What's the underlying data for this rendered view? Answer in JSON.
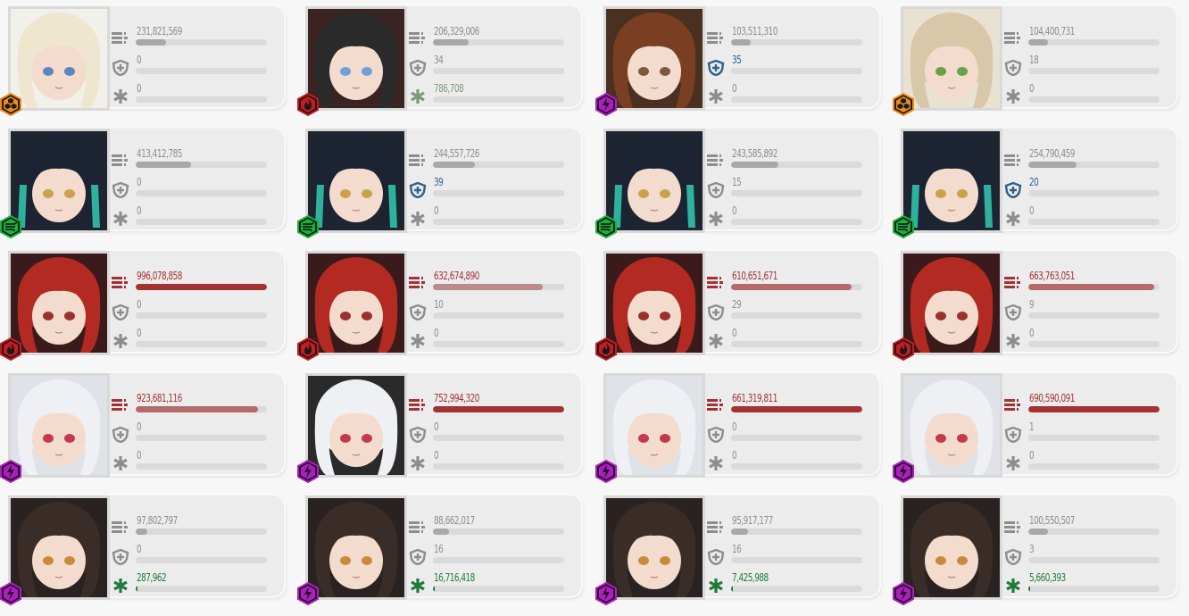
{
  "icons": {
    "damage": "damage-bars-icon",
    "shield": "shield-cross-icon",
    "heal": "heal-asterisk-icon"
  },
  "colors": {
    "grey_text": "#8d8d8d",
    "grey_bar": "#a8a8a8",
    "blue": "#2f5f8a",
    "green": "#1f7a38",
    "green_light": "#7a9a80",
    "red": "#a33234",
    "red_mid": "#b46a6b",
    "red_light": "#bb8a8a",
    "track": "#dadada"
  },
  "elements": {
    "iron": {
      "icon": "iron-element-icon",
      "color": "#f08a12"
    },
    "fire": {
      "icon": "fire-element-icon",
      "color": "#c61b20"
    },
    "electric": {
      "icon": "electric-element-icon",
      "color": "#b21ac6"
    },
    "wind": {
      "icon": "wind-element-icon",
      "color": "#14b53a"
    },
    "water": {
      "icon": "water-element-icon",
      "color": "#1b7bd6"
    }
  },
  "cards": [
    {
      "element": "iron",
      "portrait": {
        "hair": "#efe6cf",
        "bg": "#f2f0ea",
        "eye": "#5b86c2"
      },
      "damage": {
        "value": "231,821,569",
        "fill": 0.23,
        "tone": "grey"
      },
      "shield": {
        "value": "0",
        "fill": 0,
        "tone": "grey"
      },
      "heal": {
        "value": "0",
        "fill": 0,
        "tone": "grey"
      }
    },
    {
      "element": "fire",
      "portrait": {
        "hair": "#2b2b2b",
        "bg": "#3a2422",
        "eye": "#6fa0d8"
      },
      "damage": {
        "value": "206,329,006",
        "fill": 0.27,
        "tone": "grey"
      },
      "shield": {
        "value": "34",
        "fill": 0,
        "tone": "grey"
      },
      "heal": {
        "value": "786,708",
        "fill": 0,
        "tone": "green_light"
      }
    },
    {
      "element": "electric",
      "portrait": {
        "hair": "#7a3f22",
        "bg": "#4a3020",
        "eye": "#7a5a3a"
      },
      "damage": {
        "value": "103,511,310",
        "fill": 0.15,
        "tone": "grey"
      },
      "shield": {
        "value": "35",
        "fill": 0,
        "tone": "blue"
      },
      "heal": {
        "value": "0",
        "fill": 0,
        "tone": "grey"
      }
    },
    {
      "element": "iron",
      "portrait": {
        "hair": "#d8c7a8",
        "bg": "#e9e1d2",
        "eye": "#6aa048"
      },
      "damage": {
        "value": "104,400,731",
        "fill": 0.15,
        "tone": "grey"
      },
      "shield": {
        "value": "18",
        "fill": 0,
        "tone": "grey"
      },
      "heal": {
        "value": "0",
        "fill": 0,
        "tone": "grey"
      }
    },
    {
      "element": "wind",
      "portrait": {
        "hair": "#1c2333",
        "bg": "#1e2430",
        "eye": "#c9a24b",
        "accent": "#33d6b8"
      },
      "damage": {
        "value": "413,412,785",
        "fill": 0.42,
        "tone": "grey"
      },
      "shield": {
        "value": "0",
        "fill": 0,
        "tone": "grey"
      },
      "heal": {
        "value": "0",
        "fill": 0,
        "tone": "grey"
      }
    },
    {
      "element": "wind",
      "portrait": {
        "hair": "#1c2333",
        "bg": "#1e2430",
        "eye": "#c9a24b",
        "accent": "#33d6b8"
      },
      "damage": {
        "value": "244,557,726",
        "fill": 0.32,
        "tone": "grey"
      },
      "shield": {
        "value": "39",
        "fill": 0,
        "tone": "blue"
      },
      "heal": {
        "value": "0",
        "fill": 0,
        "tone": "grey"
      }
    },
    {
      "element": "wind",
      "portrait": {
        "hair": "#1c2333",
        "bg": "#1e2430",
        "eye": "#c9a24b",
        "accent": "#33d6b8"
      },
      "damage": {
        "value": "243,585,892",
        "fill": 0.36,
        "tone": "grey"
      },
      "shield": {
        "value": "15",
        "fill": 0,
        "tone": "grey"
      },
      "heal": {
        "value": "0",
        "fill": 0,
        "tone": "grey"
      }
    },
    {
      "element": "wind",
      "portrait": {
        "hair": "#1c2333",
        "bg": "#1e2430",
        "eye": "#c9a24b",
        "accent": "#33d6b8"
      },
      "damage": {
        "value": "254,790,459",
        "fill": 0.37,
        "tone": "grey"
      },
      "shield": {
        "value": "20",
        "fill": 0,
        "tone": "blue"
      },
      "heal": {
        "value": "0",
        "fill": 0,
        "tone": "grey"
      }
    },
    {
      "element": "fire",
      "portrait": {
        "hair": "#b32a22",
        "bg": "#3a1a1a",
        "eye": "#9c3030"
      },
      "damage": {
        "value": "996,078,858",
        "fill": 1.0,
        "tone": "red"
      },
      "shield": {
        "value": "0",
        "fill": 0,
        "tone": "grey"
      },
      "heal": {
        "value": "0",
        "fill": 0,
        "tone": "grey"
      }
    },
    {
      "element": "fire",
      "portrait": {
        "hair": "#b32a22",
        "bg": "#3a1a1a",
        "eye": "#9c3030"
      },
      "damage": {
        "value": "632,674,890",
        "fill": 0.84,
        "tone": "red_light"
      },
      "shield": {
        "value": "10",
        "fill": 0,
        "tone": "grey"
      },
      "heal": {
        "value": "0",
        "fill": 0,
        "tone": "grey"
      }
    },
    {
      "element": "fire",
      "portrait": {
        "hair": "#b32a22",
        "bg": "#3a1a1a",
        "eye": "#9c3030"
      },
      "damage": {
        "value": "610,651,671",
        "fill": 0.92,
        "tone": "red_mid"
      },
      "shield": {
        "value": "29",
        "fill": 0,
        "tone": "grey"
      },
      "heal": {
        "value": "0",
        "fill": 0,
        "tone": "grey"
      }
    },
    {
      "element": "fire",
      "portrait": {
        "hair": "#b32a22",
        "bg": "#3a1a1a",
        "eye": "#9c3030"
      },
      "damage": {
        "value": "663,763,051",
        "fill": 0.96,
        "tone": "red_mid"
      },
      "shield": {
        "value": "9",
        "fill": 0,
        "tone": "grey"
      },
      "heal": {
        "value": "0",
        "fill": 0,
        "tone": "grey"
      }
    },
    {
      "element": "electric",
      "portrait": {
        "hair": "#eef0f3",
        "bg": "#dfe2e6",
        "eye": "#c33a4a"
      },
      "damage": {
        "value": "923,681,116",
        "fill": 0.93,
        "tone": "red_mid"
      },
      "shield": {
        "value": "0",
        "fill": 0,
        "tone": "grey"
      },
      "heal": {
        "value": "0",
        "fill": 0,
        "tone": "grey"
      }
    },
    {
      "element": "electric",
      "portrait": {
        "hair": "#eef0f3",
        "bg": "#2a2a2a",
        "eye": "#c33a4a"
      },
      "damage": {
        "value": "752,994,320",
        "fill": 1.0,
        "tone": "red"
      },
      "shield": {
        "value": "0",
        "fill": 0,
        "tone": "grey"
      },
      "heal": {
        "value": "0",
        "fill": 0,
        "tone": "grey"
      }
    },
    {
      "element": "electric",
      "portrait": {
        "hair": "#eef0f3",
        "bg": "#dfe2e6",
        "eye": "#c33a4a"
      },
      "damage": {
        "value": "661,319,811",
        "fill": 1.0,
        "tone": "red"
      },
      "shield": {
        "value": "0",
        "fill": 0,
        "tone": "grey"
      },
      "heal": {
        "value": "0",
        "fill": 0,
        "tone": "grey"
      }
    },
    {
      "element": "electric",
      "portrait": {
        "hair": "#eef0f3",
        "bg": "#dfe2e6",
        "eye": "#c33a4a"
      },
      "damage": {
        "value": "690,590,091",
        "fill": 1.0,
        "tone": "red"
      },
      "shield": {
        "value": "1",
        "fill": 0,
        "tone": "grey"
      },
      "heal": {
        "value": "0",
        "fill": 0,
        "tone": "grey"
      }
    },
    {
      "element": "electric",
      "portrait": {
        "hair": "#3a2c26",
        "bg": "#2a2220",
        "eye": "#c98a3a"
      },
      "damage": {
        "value": "97,802,797",
        "fill": 0.09,
        "tone": "grey"
      },
      "shield": {
        "value": "0",
        "fill": 0,
        "tone": "grey"
      },
      "heal": {
        "value": "287,962",
        "fill": 0.01,
        "tone": "green"
      }
    },
    {
      "element": "electric",
      "portrait": {
        "hair": "#3a2c26",
        "bg": "#2a2220",
        "eye": "#c98a3a"
      },
      "damage": {
        "value": "88,662,017",
        "fill": 0.12,
        "tone": "grey"
      },
      "shield": {
        "value": "16",
        "fill": 0,
        "tone": "grey"
      },
      "heal": {
        "value": "16,716,418",
        "fill": 0.01,
        "tone": "green"
      }
    },
    {
      "element": "electric",
      "portrait": {
        "hair": "#3a2c26",
        "bg": "#2a2220",
        "eye": "#c98a3a"
      },
      "damage": {
        "value": "95,917,177",
        "fill": 0.13,
        "tone": "grey"
      },
      "shield": {
        "value": "16",
        "fill": 0,
        "tone": "grey"
      },
      "heal": {
        "value": "7,425,988",
        "fill": 0.01,
        "tone": "green"
      }
    },
    {
      "element": "electric",
      "portrait": {
        "hair": "#3a2c26",
        "bg": "#2a2220",
        "eye": "#c98a3a"
      },
      "damage": {
        "value": "100,550,507",
        "fill": 0.15,
        "tone": "grey"
      },
      "shield": {
        "value": "3",
        "fill": 0,
        "tone": "grey"
      },
      "heal": {
        "value": "5,660,393",
        "fill": 0.01,
        "tone": "green"
      }
    }
  ]
}
